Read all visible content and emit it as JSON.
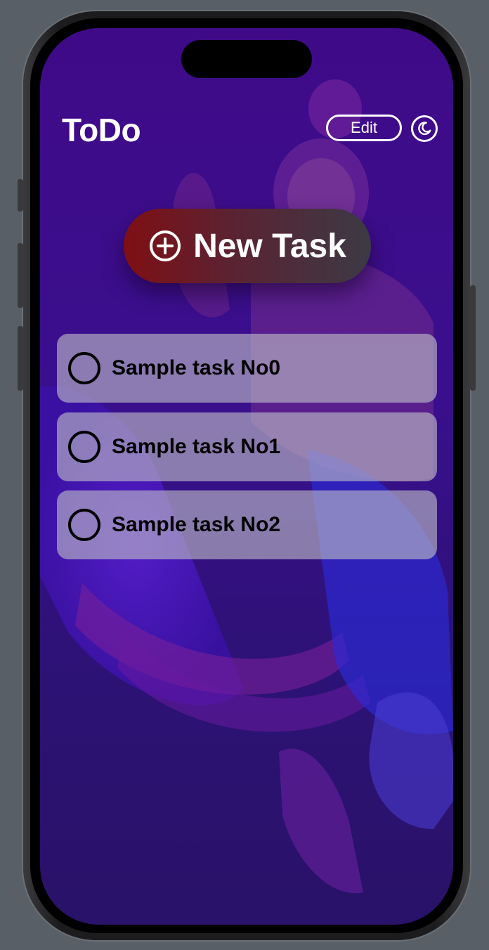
{
  "app": {
    "title": "ToDo"
  },
  "header": {
    "edit_label": "Edit",
    "theme_icon": "moon-icon"
  },
  "new_task": {
    "label": "New Task",
    "icon": "plus-circle-icon"
  },
  "tasks": [
    {
      "label": "Sample task No0",
      "done": false
    },
    {
      "label": "Sample task No1",
      "done": false
    },
    {
      "label": "Sample task No2",
      "done": false
    }
  ],
  "colors": {
    "background_top": "#3f0a88",
    "background_bottom": "#291269",
    "new_task_gradient_start": "#7f0f14",
    "new_task_gradient_end": "#3c3a45",
    "task_card": "#bebec8"
  }
}
